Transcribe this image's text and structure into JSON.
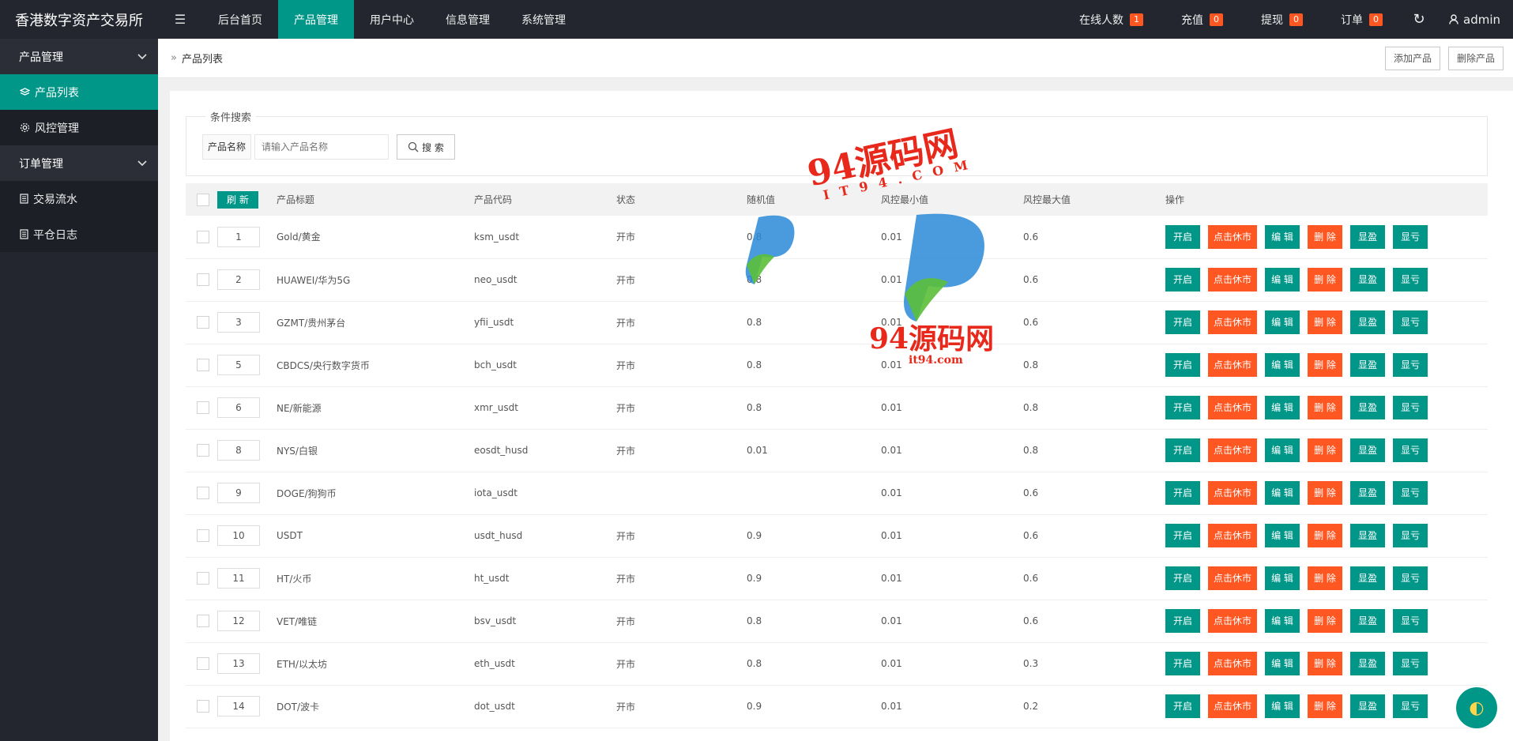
{
  "header": {
    "brand": "香港数字资产交易所",
    "menu_icon": "☰",
    "nav": [
      "后台首页",
      "产品管理",
      "用户中心",
      "信息管理",
      "系统管理"
    ],
    "stats": [
      {
        "label": "在线人数",
        "badge": "1"
      },
      {
        "label": "充值",
        "badge": "0"
      },
      {
        "label": "提现",
        "badge": "0"
      },
      {
        "label": "订单",
        "badge": "0"
      }
    ],
    "refresh_icon": "↻",
    "user": "admin"
  },
  "sidebar": {
    "groups": [
      {
        "label": "产品管理",
        "items": [
          "产品列表",
          "风控管理"
        ]
      },
      {
        "label": "订单管理",
        "items": [
          "交易流水",
          "平仓日志"
        ]
      }
    ]
  },
  "breadcrumb": {
    "current": "产品列表",
    "add_button": "添加产品",
    "delete_button": "删除产品"
  },
  "search": {
    "legend": "条件搜索",
    "label": "产品名称",
    "placeholder": "请输入产品名称",
    "button": "搜 索"
  },
  "table": {
    "refresh_label": "刷 新",
    "columns": [
      "产品标题",
      "产品代码",
      "状态",
      "随机值",
      "风控最小值",
      "风控最大值",
      "操作"
    ],
    "rows": [
      {
        "sort": "1",
        "title": "Gold/黄金",
        "code": "ksm_usdt",
        "status": "开市",
        "random": "0.8",
        "min": "0.01",
        "max": "0.6"
      },
      {
        "sort": "2",
        "title": "HUAWEI/华为5G",
        "code": "neo_usdt",
        "status": "开市",
        "random": "0.8",
        "min": "0.01",
        "max": "0.6"
      },
      {
        "sort": "3",
        "title": "GZMT/贵州茅台",
        "code": "yfii_usdt",
        "status": "开市",
        "random": "0.8",
        "min": "0.01",
        "max": "0.6"
      },
      {
        "sort": "5",
        "title": "CBDCS/央行数字货币",
        "code": "bch_usdt",
        "status": "开市",
        "random": "0.8",
        "min": "0.01",
        "max": "0.8"
      },
      {
        "sort": "6",
        "title": "NE/新能源",
        "code": "xmr_usdt",
        "status": "开市",
        "random": "0.8",
        "min": "0.01",
        "max": "0.8"
      },
      {
        "sort": "8",
        "title": "NYS/白银",
        "code": "eosdt_husd",
        "status": "开市",
        "random": "0.01",
        "min": "0.01",
        "max": "0.8"
      },
      {
        "sort": "9",
        "title": "DOGE/狗狗币",
        "code": "iota_usdt",
        "status": "",
        "random": "",
        "min": "0.01",
        "max": "0.6"
      },
      {
        "sort": "10",
        "title": "USDT",
        "code": "usdt_husd",
        "status": "开市",
        "random": "0.9",
        "min": "0.01",
        "max": "0.6"
      },
      {
        "sort": "11",
        "title": "HT/火币",
        "code": "ht_usdt",
        "status": "开市",
        "random": "0.9",
        "min": "0.01",
        "max": "0.6"
      },
      {
        "sort": "12",
        "title": "VET/唯链",
        "code": "bsv_usdt",
        "status": "开市",
        "random": "0.8",
        "min": "0.01",
        "max": "0.6"
      },
      {
        "sort": "13",
        "title": "ETH/以太坊",
        "code": "eth_usdt",
        "status": "开市",
        "random": "0.8",
        "min": "0.01",
        "max": "0.3"
      },
      {
        "sort": "14",
        "title": "DOT/波卡",
        "code": "dot_usdt",
        "status": "开市",
        "random": "0.9",
        "min": "0.01",
        "max": "0.2"
      }
    ],
    "ops": [
      "开启",
      "点击休市",
      "编 辑",
      "删 除",
      "显盈",
      "显亏"
    ]
  },
  "watermark": {
    "top_text": "94源码网",
    "top_sub": "I T 9 4 . C O M",
    "bottom_text": "94源码网",
    "bottom_sub": "it94.com"
  },
  "colors": {
    "accent": "#009688",
    "danger": "#ff5722",
    "dark": "#23262e"
  }
}
